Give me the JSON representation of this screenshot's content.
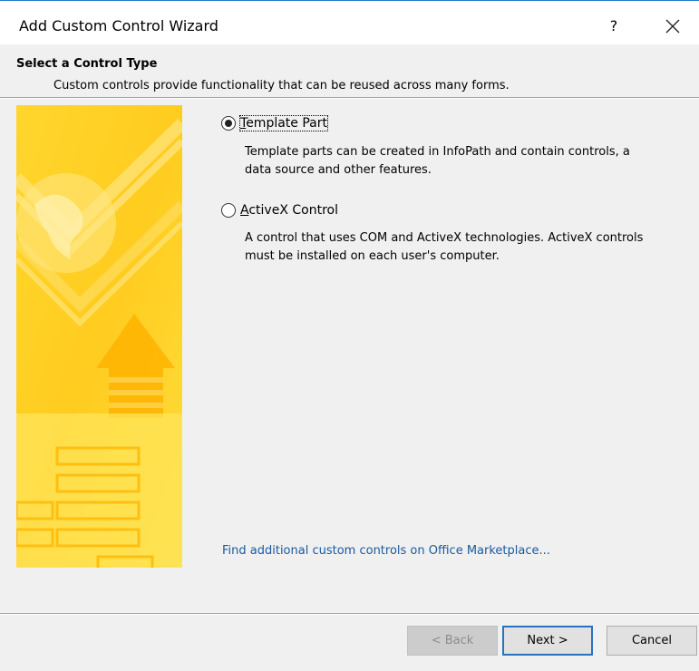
{
  "window": {
    "title": "Add Custom Control Wizard",
    "help_label": "?",
    "close_icon": "close-icon"
  },
  "header": {
    "heading": "Select a Control Type",
    "subheading": "Custom controls provide functionality that can be reused across many forms."
  },
  "options": [
    {
      "label": "Template Part",
      "access_key": "T",
      "selected": true,
      "description": [
        "Template parts can be created in InfoPath and contain controls, a",
        "data source and other features."
      ]
    },
    {
      "label": "ActiveX Control",
      "access_key": "A",
      "selected": false,
      "description": [
        "A control that uses COM and ActiveX technologies. ActiveX controls",
        "must be installed on each user's computer."
      ]
    }
  ],
  "link": {
    "text": "Find additional custom controls on Office Marketplace..."
  },
  "buttons": {
    "back": "< Back",
    "next": "Next >",
    "cancel": "Cancel"
  },
  "colors": {
    "accent": "#2a71c0",
    "link": "#1a5aa0",
    "art_yellow": "#ffd428",
    "dialog_bg": "#f0f0f0"
  }
}
